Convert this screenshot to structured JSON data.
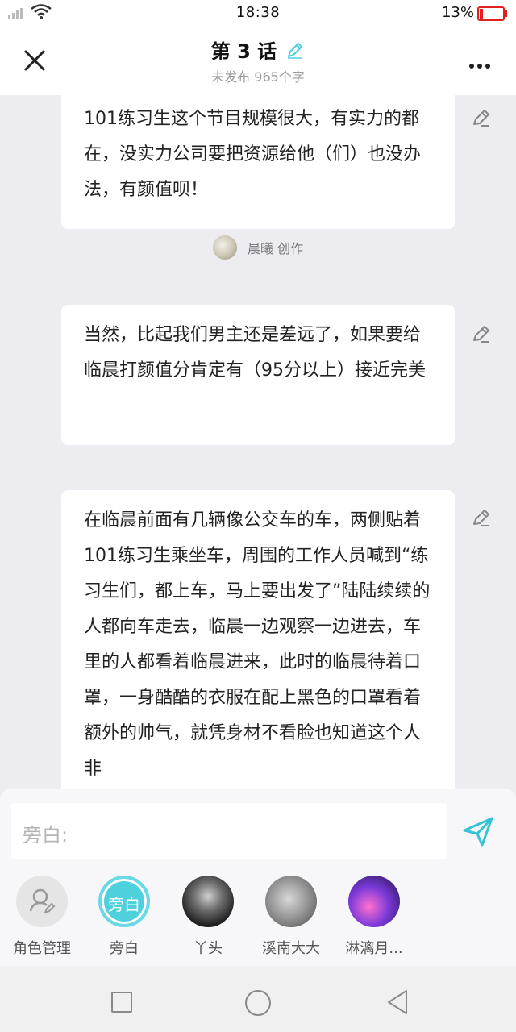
{
  "status_bar": {
    "time": "18:38",
    "battery_percent": "13%",
    "battery_level": 0.13
  },
  "header": {
    "title": "第 3 话",
    "subtitle": "未发布 965个字"
  },
  "feed": {
    "cards": [
      {
        "text": "101练习生这个节目规模很大，有实力的都在，没实力公司要把资源给他（们）也没办法，有颜值呗！"
      },
      {
        "text": "当然，比起我们男主还是差远了，如果要给临晨打颜值分肯定有（95分以上）接近完美"
      },
      {
        "text": "在临晨前面有几辆像公交车的车，两侧贴着101练习生乘坐车，周围的工作人员喊到“练习生们，都上车，马上要出发了”陆陆续续的人都向车走去，临晨一边观察一边进去，车里的人都看着临晨进来，此时的临晨待着口罩，一身酷酷的衣服在配上黑色的口罩看着额外的帅气，就凭身材不看脸也知道这个人非"
      }
    ],
    "author": {
      "name": "晨曦",
      "action": "创作"
    }
  },
  "composer": {
    "placeholder": "旁白:"
  },
  "roles": [
    {
      "name": "角色管理",
      "icon": "person-edit-icon"
    },
    {
      "name": "旁白",
      "badge": "旁白",
      "active": true
    },
    {
      "name": "丫头"
    },
    {
      "name": "溪南大大"
    },
    {
      "name": "淋漓月..."
    }
  ],
  "colors": {
    "accent": "#4fd0dd",
    "background": "#ececf1",
    "card": "#ffffff",
    "battery_low": "#e02020"
  }
}
